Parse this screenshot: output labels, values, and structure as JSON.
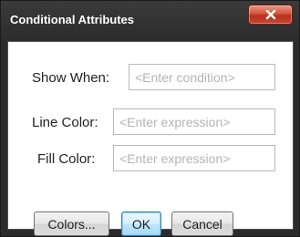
{
  "window": {
    "title": "Conditional Attributes",
    "close_icon": "close-x-icon"
  },
  "form": {
    "show_when": {
      "label": "Show When:",
      "placeholder": "<Enter condition>"
    },
    "line_color": {
      "label": "Line Color:",
      "placeholder": "<Enter expression>"
    },
    "fill_color": {
      "label": "Fill Color:",
      "placeholder": "<Enter expression>"
    }
  },
  "buttons": {
    "colors": "Colors...",
    "ok": "OK",
    "cancel": "Cancel"
  },
  "colors": {
    "titlebar": "#2c2c2c",
    "close_button": "#c8452c",
    "default_button_border": "#3c7fb1"
  }
}
